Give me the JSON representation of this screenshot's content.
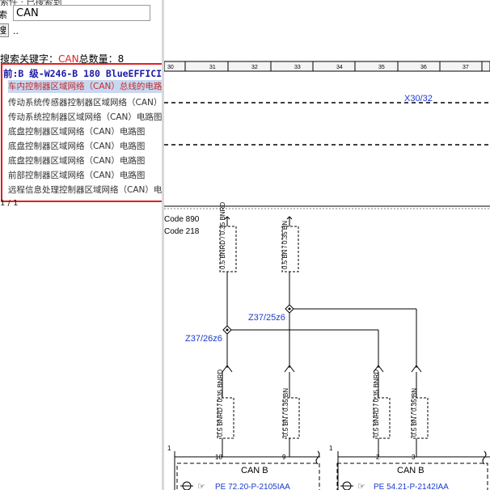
{
  "search": {
    "field_label": "索",
    "value": "CAN",
    "top_partial_text": "索件 · 已搜索到",
    "button_label": "搜",
    "dots": ".."
  },
  "result_summary": {
    "prefix": "搜索关键字：",
    "keyword": "CAN",
    "count_text": "总数量：8"
  },
  "results": {
    "breadcrumb": "前:B 级-W246-B 180 BlueEFFICIENCY",
    "items": [
      "车内控制器区域网络（CAN）总线的电路图",
      "传动系统传感器控制器区域网络（CAN）电路图",
      "传动系统控制器区域网络（CAN）电路图",
      "底盘控制器区域网络（CAN）电路图",
      "底盘控制器区域网络（CAN）电路图",
      "底盘控制器区域网络（CAN）电路图",
      "前部控制器区域网络（CAN）电路图",
      "远程信息处理控制器区域网络（CAN）电路图"
    ],
    "pager": "1 / 1"
  },
  "diagram": {
    "ruler_ticks": [
      "30",
      "31",
      "32",
      "33",
      "34",
      "35",
      "36",
      "37"
    ],
    "connector_label": "X30/32",
    "code_line1": "Code 890",
    "code_line2": "Code 218",
    "wire_top_left": "0.5 BNRD / 0.35 BNRD",
    "wire_top_right": "0.5 BN / 0.35 BN",
    "splice_a": "Z37/25z6",
    "splice_b": "Z37/26z6",
    "wire_bottom_1": "0.5 BNRD / 0.35 BNRD",
    "wire_bottom_2": "0.5 BN / 0.35 BN",
    "wire_bottom_3": "0.5 BNRD / 0.35 BNRD",
    "wire_bottom_4": "0.5 BN / 0.35 BN",
    "pin_labels": [
      "1",
      "10",
      "9",
      "1",
      "2",
      "3"
    ],
    "module_left_bus": "CAN B",
    "module_right_bus": "CAN B",
    "module_left_ref": "PE 72.20-P-2105IAA",
    "module_right_ref": "PE 54.21-P-2142IAA"
  }
}
